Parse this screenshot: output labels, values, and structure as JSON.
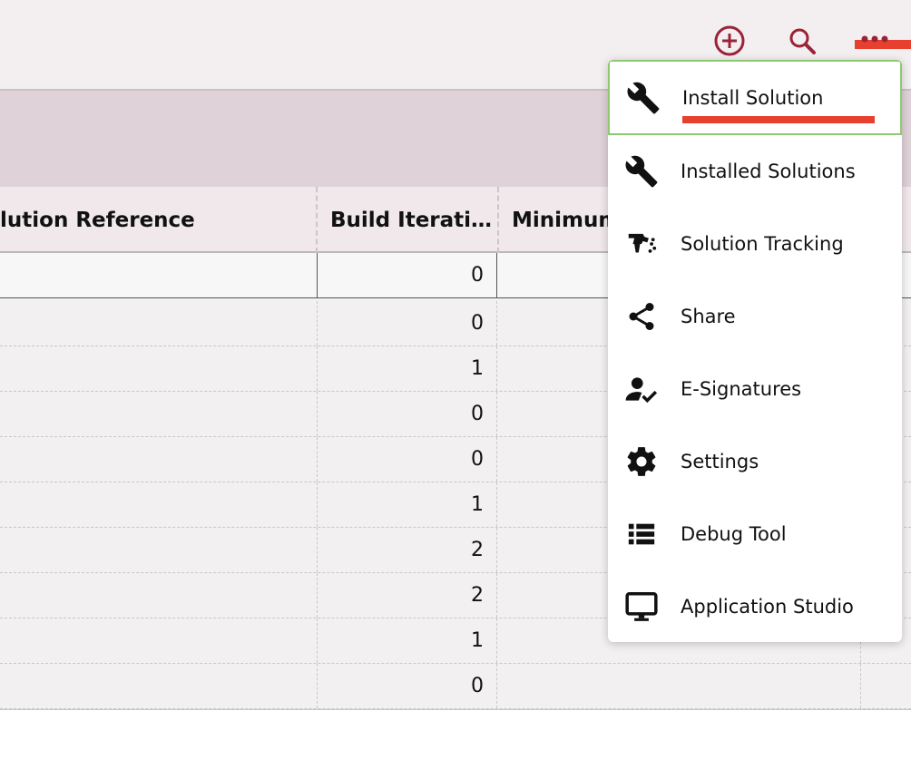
{
  "colors": {
    "accent": "#9b2335",
    "highlight": "#e8402e",
    "active_border": "#8dc96f"
  },
  "toolbar": {
    "add_icon": "add-circle-icon",
    "search_icon": "search-icon",
    "more_icon": "more-horizontal-icon"
  },
  "grid": {
    "columns": [
      "lution Reference",
      "Build Iterati…",
      "Minimum"
    ],
    "build_iterations": [
      "0",
      "0",
      "1",
      "0",
      "0",
      "1",
      "2",
      "2",
      "1",
      "0"
    ]
  },
  "menu": {
    "items": [
      {
        "label": "Install Solution",
        "icon": "wrench-icon"
      },
      {
        "label": "Installed Solutions",
        "icon": "wrench-icon"
      },
      {
        "label": "Solution Tracking",
        "icon": "paint-spray-icon"
      },
      {
        "label": "Share",
        "icon": "share-icon"
      },
      {
        "label": "E-Signatures",
        "icon": "user-check-icon"
      },
      {
        "label": "Settings",
        "icon": "gear-icon"
      },
      {
        "label": "Debug Tool",
        "icon": "list-icon"
      },
      {
        "label": "Application Studio",
        "icon": "monitor-icon"
      }
    ]
  }
}
